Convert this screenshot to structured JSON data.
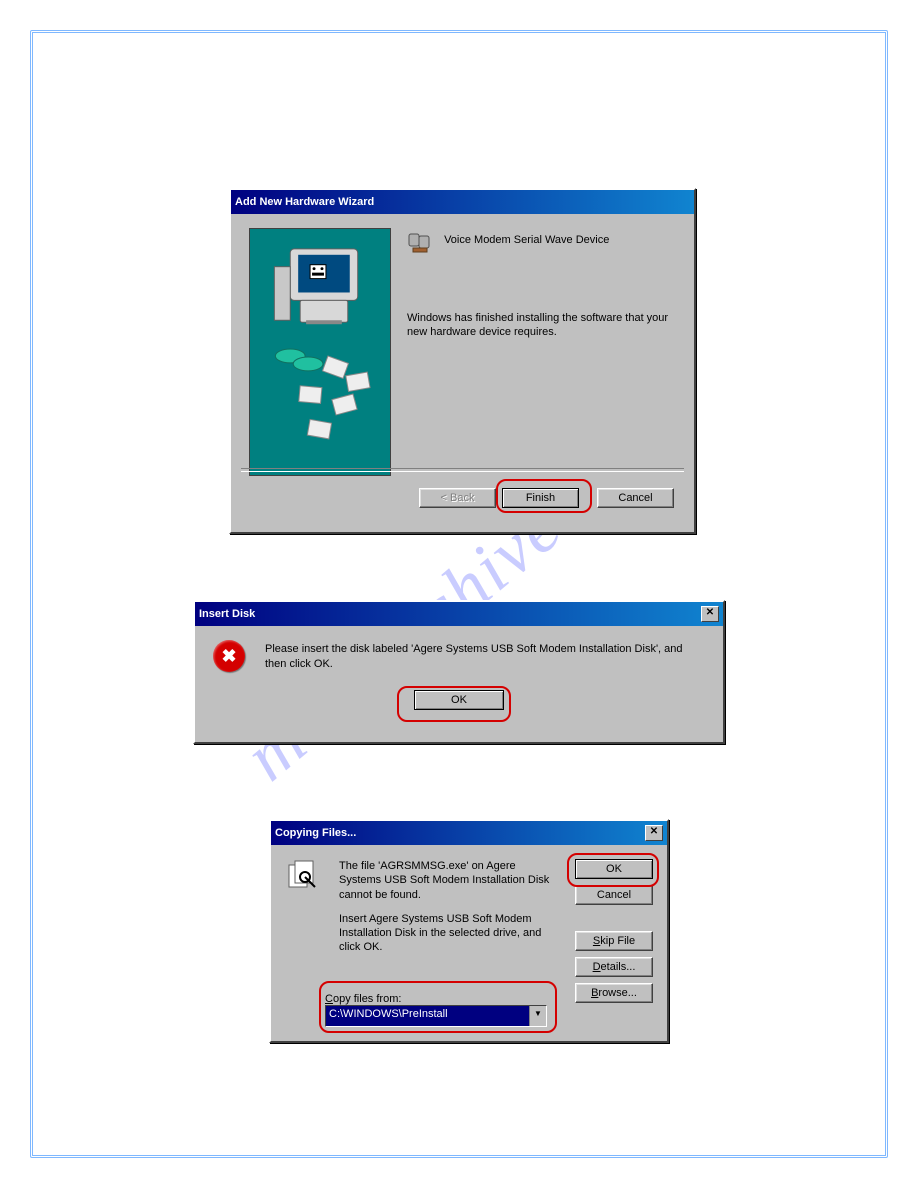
{
  "watermark": "manualshive.com",
  "dialog1": {
    "title": "Add New Hardware Wizard",
    "device_name": "Voice Modem Serial Wave Device",
    "message": "Windows has finished installing the software that your new hardware device requires.",
    "back_btn": "< Back",
    "finish_btn": "Finish",
    "cancel_btn": "Cancel"
  },
  "dialog2": {
    "title": "Insert Disk",
    "message": "Please insert the disk labeled 'Agere Systems USB Soft Modem Installation Disk', and then click OK.",
    "ok_btn": "OK"
  },
  "dialog3": {
    "title": "Copying Files...",
    "message1": "The file 'AGRSMMSG.exe' on Agere Systems USB Soft Modem Installation Disk cannot be found.",
    "message2": "Insert Agere Systems USB Soft Modem Installation Disk in the selected drive, and click OK.",
    "copy_label": "Copy files from:",
    "copy_value": "C:\\WINDOWS\\PreInstall",
    "ok_btn": "OK",
    "cancel_btn": "Cancel",
    "skip_btn": "Skip File",
    "details_btn": "Details...",
    "browse_btn": "Browse..."
  }
}
